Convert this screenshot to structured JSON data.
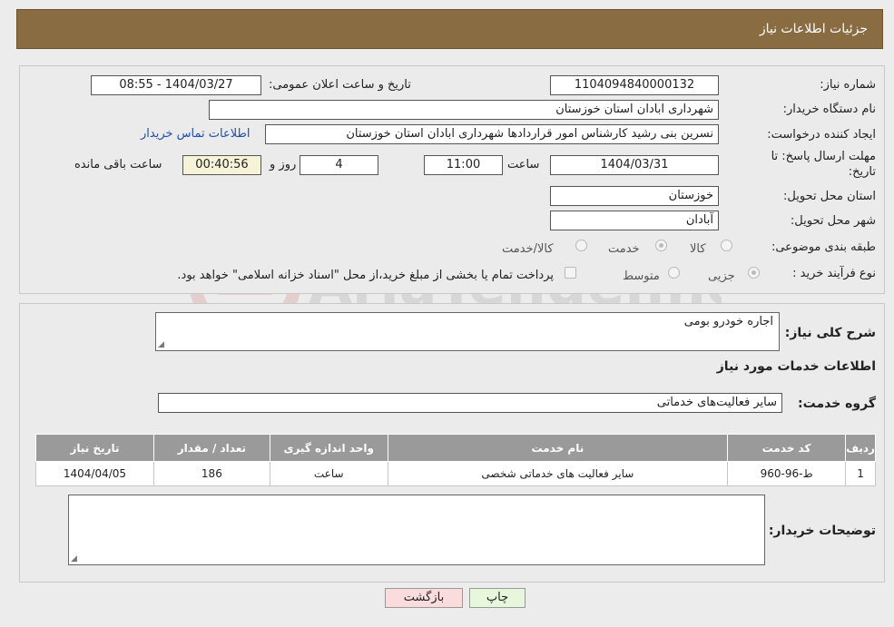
{
  "header": {
    "title": "جزئیات اطلاعات نیاز"
  },
  "watermark": {
    "text": "AriaTender.neT"
  },
  "form": {
    "need_number_label": "شماره نیاز:",
    "need_number": "1104094840000132",
    "announce_label": "تاریخ و ساعت اعلان عمومی:",
    "announce_value": "1404/03/27 - 08:55",
    "buyer_org_label": "نام دستگاه خریدار:",
    "buyer_org": "شهرداری ابادان استان خوزستان",
    "creator_label": "ایجاد کننده درخواست:",
    "creator": "نسرین بنی رشید کارشناس امور قراردادها شهرداری ابادان استان خوزستان",
    "contact_link": "اطلاعات تماس خریدار",
    "deadline_label_1": "مهلت ارسال پاسخ: تا",
    "deadline_label_2": "تاریخ:",
    "deadline_date": "1404/03/31",
    "time_label": "ساعت",
    "deadline_time": "11:00",
    "days_value": "4",
    "days_label": "روز و",
    "remaining_time": "00:40:56",
    "remaining_label": "ساعت باقی مانده",
    "province_label": "استان محل تحویل:",
    "province": "خوزستان",
    "city_label": "شهر محل تحویل:",
    "city": "آبادان",
    "category_label": "طبقه بندی موضوعی:",
    "category_options": [
      "کالا",
      "خدمت",
      "کالا/خدمت"
    ],
    "process_label": "نوع فرآیند خرید :",
    "process_options": [
      "جزیی",
      "متوسط"
    ],
    "process_note": "پرداخت تمام یا بخشی از مبلغ خرید،از محل \"اسناد خزانه اسلامی\" خواهد بود."
  },
  "details": {
    "summary_label": "شرح کلی نیاز:",
    "summary": "اجاره خودرو بومی",
    "services_title": "اطلاعات خدمات مورد نیاز",
    "service_group_label": "گروه خدمت:",
    "service_group": "سایر فعالیت‌های خدماتی",
    "table": {
      "headers": [
        "ردیف",
        "کد خدمت",
        "نام خدمت",
        "واحد اندازه گیری",
        "تعداد / مقدار",
        "تاریخ نیاز"
      ],
      "rows": [
        [
          "1",
          "ط-96-960",
          "سایر فعالیت های خدماتی شخصی",
          "ساعت",
          "186",
          "1404/04/05"
        ]
      ]
    },
    "buyer_notes_label": "توضیحات خریدار:",
    "buyer_notes": ""
  },
  "buttons": {
    "print": "چاپ",
    "back": "بازگشت"
  },
  "colors": {
    "header_bg": "#8a6c43",
    "link": "#1f4fb0",
    "time_bg": "#f7f3d8",
    "back_bg": "#fbdcdc",
    "print_bg": "#e6f7dc"
  }
}
